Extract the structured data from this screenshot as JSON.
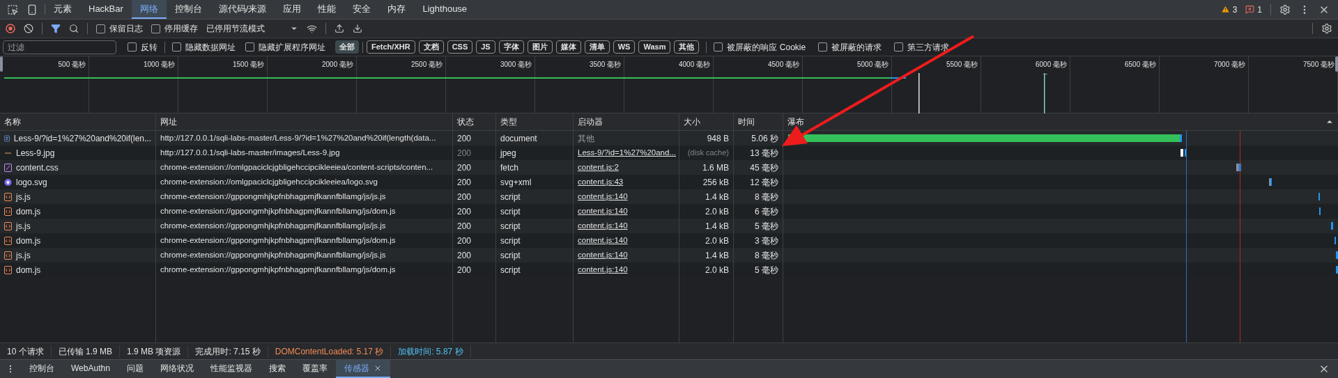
{
  "main_tabs": [
    {
      "label": "元素",
      "selected": false
    },
    {
      "label": "HackBar",
      "selected": false
    },
    {
      "label": "网络",
      "selected": true
    },
    {
      "label": "控制台",
      "selected": false
    },
    {
      "label": "源代码/来源",
      "selected": false
    },
    {
      "label": "应用",
      "selected": false
    },
    {
      "label": "性能",
      "selected": false
    },
    {
      "label": "安全",
      "selected": false
    },
    {
      "label": "内存",
      "selected": false
    },
    {
      "label": "Lighthouse",
      "selected": false
    }
  ],
  "issues": {
    "warnings": "3",
    "errors": "1"
  },
  "toolbar": {
    "recording": true,
    "checkboxes": [
      {
        "label": "保留日志",
        "checked": false
      },
      {
        "label": "停用缓存",
        "checked": false
      }
    ],
    "throttle": "已停用节流模式"
  },
  "filter": {
    "placeholder": "过滤",
    "invert": {
      "label": "反转",
      "checked": false
    },
    "options": [
      {
        "label": "隐藏数据网址",
        "checked": false
      },
      {
        "label": "隐藏扩展程序网址",
        "checked": false
      }
    ],
    "types": [
      {
        "label": "全部",
        "selected": true
      },
      {
        "label": "Fetch/XHR",
        "selected": false
      },
      {
        "label": "文档",
        "selected": false
      },
      {
        "label": "CSS",
        "selected": false
      },
      {
        "label": "JS",
        "selected": false
      },
      {
        "label": "字体",
        "selected": false
      },
      {
        "label": "图片",
        "selected": false
      },
      {
        "label": "媒体",
        "selected": false
      },
      {
        "label": "清单",
        "selected": false
      },
      {
        "label": "WS",
        "selected": false
      },
      {
        "label": "Wasm",
        "selected": false
      },
      {
        "label": "其他",
        "selected": false
      }
    ],
    "extra": [
      {
        "label": "被屏蔽的响应 Cookie",
        "checked": false
      },
      {
        "label": "被屏蔽的请求",
        "checked": false
      },
      {
        "label": "第三方请求",
        "checked": false
      }
    ]
  },
  "overview_ticks": [
    "500 毫秒",
    "1000 毫秒",
    "1500 毫秒",
    "2000 毫秒",
    "2500 毫秒",
    "3000 毫秒",
    "3500 毫秒",
    "4000 毫秒",
    "4500 毫秒",
    "5000 毫秒",
    "5500 毫秒",
    "6000 毫秒",
    "6500 毫秒",
    "7000 毫秒",
    "7500 毫秒"
  ],
  "table": {
    "columns": [
      "名称",
      "网址",
      "状态",
      "类型",
      "启动器",
      "大小",
      "时间",
      "瀑布"
    ],
    "rows": [
      {
        "kind": "document",
        "name": "Less-9/?id=1%27%20and%20if(len...",
        "url": "http://127.0.0.1/sqli-labs-master/Less-9/?id=1%27%20and%20if(length(data...",
        "status": "200",
        "type": "document",
        "initiator": "其他",
        "initiator_link": false,
        "size": "948 B",
        "cached": false,
        "time": "5.06 秒"
      },
      {
        "kind": "image",
        "name": "Less-9.jpg",
        "url": "http://127.0.0.1/sqli-labs-master/images/Less-9.jpg",
        "status": "200",
        "type": "jpeg",
        "initiator": "Less-9/?id=1%27%20and...",
        "initiator_link": true,
        "size": "(disk cache)",
        "cached": true,
        "time": "13 毫秒"
      },
      {
        "kind": "stylesheet",
        "name": "content.css",
        "url": "chrome-extension://omlgpaciclcjgbligehccipcikleeiea/content-scripts/conten...",
        "status": "200",
        "type": "fetch",
        "initiator": "content.js:2",
        "initiator_link": true,
        "size": "1.6 MB",
        "cached": false,
        "time": "45 毫秒"
      },
      {
        "kind": "svg",
        "name": "logo.svg",
        "url": "chrome-extension://omlgpaciclcjgbligehccipcikleeiea/logo.svg",
        "status": "200",
        "type": "svg+xml",
        "initiator": "content.js:43",
        "initiator_link": true,
        "size": "256 kB",
        "cached": false,
        "time": "12 毫秒"
      },
      {
        "kind": "script",
        "name": "js.js",
        "url": "chrome-extension://gppongmhjkpfnbhagpmjfkannfbllamg/js/js.js",
        "status": "200",
        "type": "script",
        "initiator": "content.js:140",
        "initiator_link": true,
        "size": "1.4 kB",
        "cached": false,
        "time": "8 毫秒"
      },
      {
        "kind": "script",
        "name": "dom.js",
        "url": "chrome-extension://gppongmhjkpfnbhagpmjfkannfbllamg/js/dom.js",
        "status": "200",
        "type": "script",
        "initiator": "content.js:140",
        "initiator_link": true,
        "size": "2.0 kB",
        "cached": false,
        "time": "6 毫秒"
      },
      {
        "kind": "script",
        "name": "js.js",
        "url": "chrome-extension://gppongmhjkpfnbhagpmjfkannfbllamg/js/js.js",
        "status": "200",
        "type": "script",
        "initiator": "content.js:140",
        "initiator_link": true,
        "size": "1.4 kB",
        "cached": false,
        "time": "5 毫秒"
      },
      {
        "kind": "script",
        "name": "dom.js",
        "url": "chrome-extension://gppongmhjkpfnbhagpmjfkannfbllamg/js/dom.js",
        "status": "200",
        "type": "script",
        "initiator": "content.js:140",
        "initiator_link": true,
        "size": "2.0 kB",
        "cached": false,
        "time": "3 毫秒"
      },
      {
        "kind": "script",
        "name": "js.js",
        "url": "chrome-extension://gppongmhjkpfnbhagpmjfkannfbllamg/js/js.js",
        "status": "200",
        "type": "script",
        "initiator": "content.js:140",
        "initiator_link": true,
        "size": "1.4 kB",
        "cached": false,
        "time": "8 毫秒"
      },
      {
        "kind": "script",
        "name": "dom.js",
        "url": "chrome-extension://gppongmhjkpfnbhagpmjfkannfbllamg/js/dom.js",
        "status": "200",
        "type": "script",
        "initiator": "content.js:140",
        "initiator_link": true,
        "size": "2.0 kB",
        "cached": false,
        "time": "5 毫秒"
      }
    ]
  },
  "status_bar": [
    {
      "kind": "plain",
      "text": "10 个请求"
    },
    {
      "kind": "plain",
      "text": "已传输 1.9 MB"
    },
    {
      "kind": "plain",
      "text": "1.9 MB 项资源"
    },
    {
      "kind": "plain",
      "text": "完成用时: 7.15 秒"
    },
    {
      "kind": "dom",
      "text": "DOMContentLoaded: 5.17 秒"
    },
    {
      "kind": "load",
      "text": "加载时间: 5.87 秒"
    }
  ],
  "drawer_tabs": [
    {
      "label": "控制台",
      "selected": false
    },
    {
      "label": "WebAuthn",
      "selected": false
    },
    {
      "label": "问题",
      "selected": false
    },
    {
      "label": "网络状况",
      "selected": false
    },
    {
      "label": "性能监视器",
      "selected": false
    },
    {
      "label": "搜索",
      "selected": false
    },
    {
      "label": "覆盖率",
      "selected": false
    },
    {
      "label": "传感器",
      "selected": true
    }
  ]
}
